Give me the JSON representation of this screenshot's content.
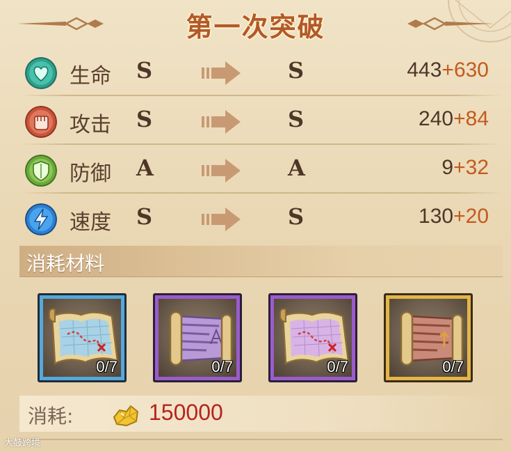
{
  "title": "第一次突破",
  "stats": [
    {
      "name": "生命",
      "icon": "heart-icon",
      "from": "S",
      "to": "S",
      "base": "443",
      "bonus": "+630"
    },
    {
      "name": "攻击",
      "icon": "fist-icon",
      "from": "S",
      "to": "S",
      "base": "240",
      "bonus": "+84"
    },
    {
      "name": "防御",
      "icon": "shield-icon",
      "from": "A",
      "to": "A",
      "base": "9",
      "bonus": "+32"
    },
    {
      "name": "速度",
      "icon": "lightning-icon",
      "from": "S",
      "to": "S",
      "base": "130",
      "bonus": "+20"
    }
  ],
  "materials": {
    "header": "消耗材料",
    "items": [
      {
        "icon": "treasure-map-icon",
        "rarity": "blue",
        "count": "0/7"
      },
      {
        "icon": "scroll-icon",
        "rarity": "purple",
        "count": "0/7"
      },
      {
        "icon": "treasure-map-icon",
        "rarity": "purple",
        "count": "0/7"
      },
      {
        "icon": "scroll-icon",
        "rarity": "gold",
        "count": "0/7"
      }
    ]
  },
  "cost": {
    "label": "消耗:",
    "icon": "gold-nugget-icon",
    "value": "150000"
  },
  "watermark": "大鼓跨境",
  "colors": {
    "title": "#b25a27",
    "bonus": "#c25a1e",
    "cost": "#b5241d",
    "blue": "#55a8d8",
    "purple": "#9a5ccb",
    "gold": "#e4b548"
  }
}
